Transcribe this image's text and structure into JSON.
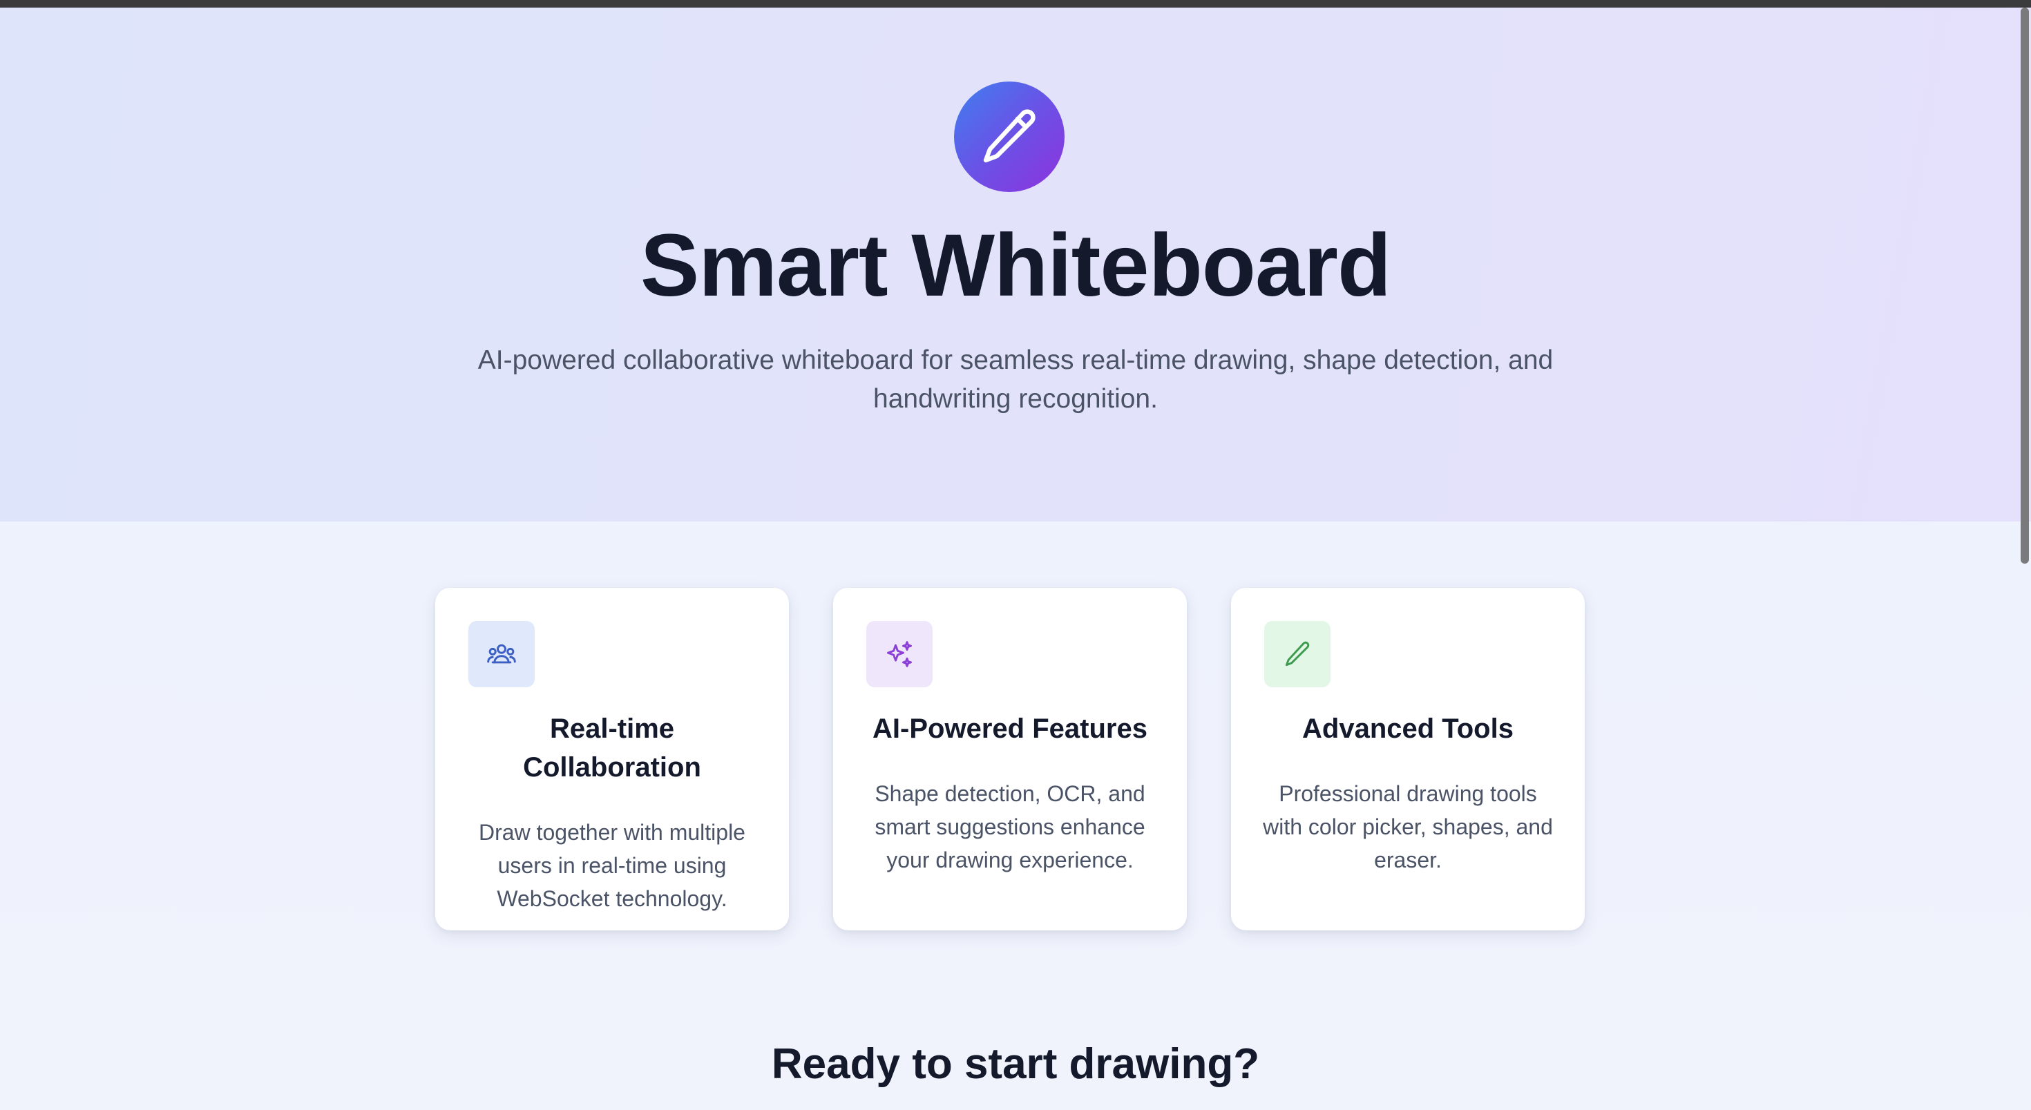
{
  "hero": {
    "logo_icon": "pencil-icon",
    "title": "Smart Whiteboard",
    "subtitle": "AI-powered collaborative whiteboard for seamless real-time drawing, shape detection, and handwriting recognition."
  },
  "features": [
    {
      "icon": "users-icon",
      "icon_color": "#3b5fc4",
      "icon_bg": "#e0e9fb",
      "title": "Real-time Collaboration",
      "description": "Draw together with multiple users in real-time using WebSocket technology."
    },
    {
      "icon": "sparkles-icon",
      "icon_color": "#8b3fd6",
      "icon_bg": "#f0e6fb",
      "title": "AI-Powered Features",
      "description": "Shape detection, OCR, and smart suggestions enhance your drawing experience."
    },
    {
      "icon": "pencil-icon",
      "icon_color": "#3d9b50",
      "icon_bg": "#e2f7e6",
      "title": "Advanced Tools",
      "description": "Professional drawing tools with color picker, shapes, and eraser."
    }
  ],
  "cta": {
    "title": "Ready to start drawing?"
  },
  "colors": {
    "accent_start": "#3f7ff0",
    "accent_end": "#8e32dd",
    "text_dark": "#141a2c",
    "text_muted": "#4b5366"
  }
}
